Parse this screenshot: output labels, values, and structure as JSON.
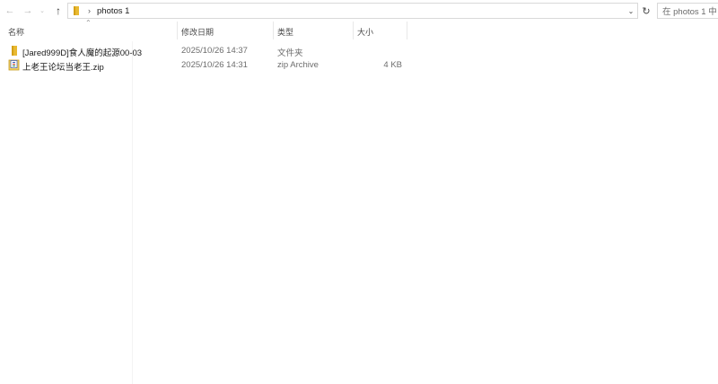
{
  "nav": {
    "back_glyph": "←",
    "forward_glyph": "→",
    "recent_glyph": "⌄",
    "up_glyph": "↑"
  },
  "address": {
    "separator": "›",
    "path": "photos 1",
    "dropdown_glyph": "⌄",
    "refresh_glyph": "↻"
  },
  "search": {
    "placeholder": "在 photos 1 中"
  },
  "columns": {
    "sort_glyph": "⌃",
    "name": "名称",
    "date": "修改日期",
    "type": "类型",
    "size": "大小"
  },
  "files": [
    {
      "name": "[Jared999D]食人魔的起源00-03",
      "date": "2025/10/26 14:37",
      "type": "文件夹",
      "size": "",
      "icon": "folder-icon"
    },
    {
      "name": "上老王论坛当老王.zip",
      "date": "2025/10/26 14:31",
      "type": "zip Archive",
      "size": "4 KB",
      "icon": "zip-archive-icon"
    }
  ],
  "colors": {
    "folder": "#e8b931",
    "folder_dark": "#d4a017",
    "zip_accent": "#3b5bb5",
    "border": "#d9d9d9"
  }
}
